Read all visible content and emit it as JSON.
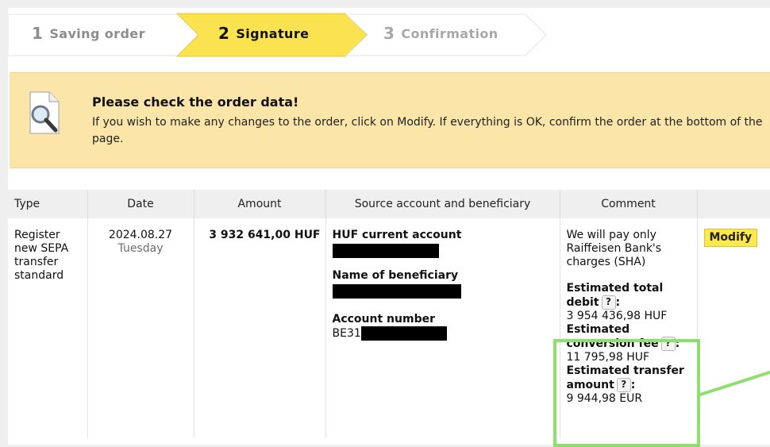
{
  "steps": [
    {
      "num": "1",
      "label": "Saving order"
    },
    {
      "num": "2",
      "label": "Signature"
    },
    {
      "num": "3",
      "label": "Confirmation"
    }
  ],
  "notice": {
    "icon": "magnifier-document-icon",
    "title": "Please check the order data!",
    "text": "If you wish to make any changes to the order, click on Modify. If everything is OK, confirm the order at the bottom of the page."
  },
  "table": {
    "headers": [
      "Type",
      "Date",
      "Amount",
      "Source account and beneficiary",
      "Comment",
      ""
    ],
    "row": {
      "type": "Register new SEPA transfer standard",
      "date": "2024.08.27",
      "weekday": "Tuesday",
      "amount": "3 932 641,00 HUF",
      "source_label": "HUF current account",
      "beneficiary_label": "Name of beneficiary",
      "account_label": "Account number",
      "account_prefix": "BE31",
      "comment_intro": "We will pay only Raiffeisen Bank's charges (SHA)",
      "total_debit_label_1": "Estimated total",
      "total_debit_label_2": "debit",
      "total_debit_value": "3 954 436,98 HUF",
      "conversion_fee_label_1": "Estimated",
      "conversion_fee_label_2": "conversion fee",
      "conversion_fee_value": "11 795,98 HUF",
      "transfer_amount_label_1": "Estimated transfer",
      "transfer_amount_label_2": "amount",
      "transfer_amount_value": "9 944,98 EUR",
      "help_symbol": "?",
      "colon": ":",
      "modify_label": "Modify"
    }
  },
  "colors": {
    "active_step": "#fbe350",
    "notice_bg": "#fbe5a9",
    "modify_button": "#fde94e",
    "highlight": "#8ee06d"
  }
}
